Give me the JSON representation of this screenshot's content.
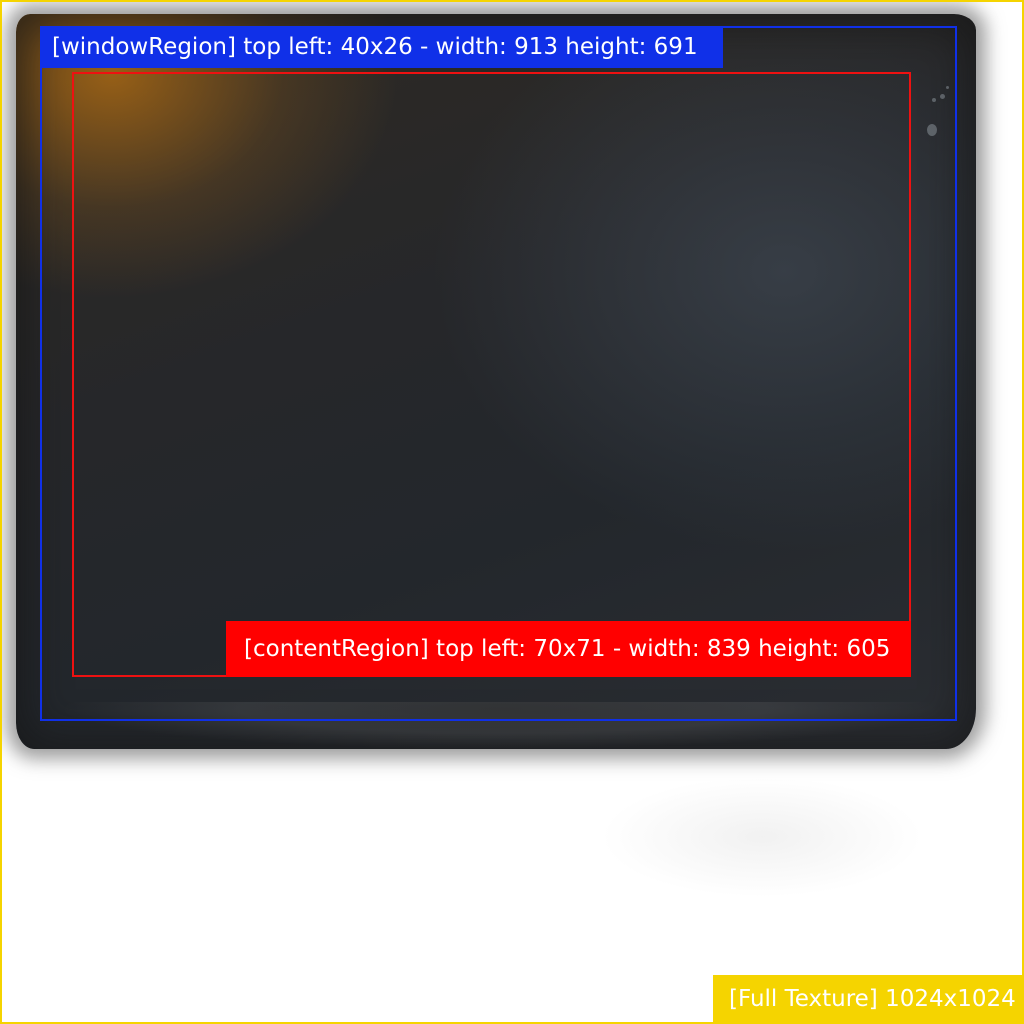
{
  "window_region": {
    "label": "[windowRegion] top left: 40x26 - width: 913  height: 691",
    "color": "#1030e8"
  },
  "content_region": {
    "label": "[contentRegion] top left: 70x71 - width: 839 height: 605",
    "color": "#ff0000"
  },
  "full_texture": {
    "label": "[Full Texture] 1024x1024",
    "color": "#f5d400"
  }
}
